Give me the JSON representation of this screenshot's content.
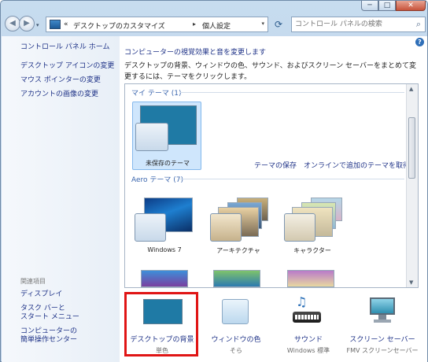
{
  "window": {
    "controls": {
      "minimize": "─",
      "maximize": "□",
      "close": "✕"
    }
  },
  "nav": {
    "back_icon": "back-arrow-icon",
    "forward_icon": "forward-arrow-icon",
    "breadcrumb": [
      "デスクトップのカスタマイズ",
      "個人設定"
    ],
    "breadcrumb_prefix": "«",
    "separator": "▸",
    "search_placeholder": "コントロール パネルの検索"
  },
  "sidebar": {
    "home": "コントロール パネル ホーム",
    "links": [
      "デスクトップ アイコンの変更",
      "マウス ポインターの変更",
      "アカウントの画像の変更"
    ],
    "see_also_heading": "関連項目",
    "see_also": [
      "ディスプレイ",
      "タスク バーと\nスタート メニュー",
      "コンピューターの\n簡単操作センター"
    ]
  },
  "main": {
    "title": "コンピューターの視覚効果と音を変更します",
    "description": "デスクトップの背景、ウィンドウの色、サウンド、およびスクリーン セーバーをまとめて変更するには、テーマをクリックします。",
    "my_themes_heading": "マイ テーマ (1)",
    "unsaved_theme": "未保存のテーマ",
    "save_theme_link": "テーマの保存",
    "online_link": "オンラインで追加のテーマを取得",
    "aero_heading": "Aero テーマ (7)",
    "aero_themes": [
      "Windows 7",
      "アーキテクチャ",
      "キャラクター"
    ]
  },
  "bottom": {
    "items": [
      {
        "label": "デスクトップの背景",
        "sub": "単色",
        "icon": "desktop-background-icon"
      },
      {
        "label": "ウィンドウの色",
        "sub": "そら",
        "icon": "window-color-icon"
      },
      {
        "label": "サウンド",
        "sub": "Windows 標準",
        "icon": "sound-notes-icon"
      },
      {
        "label": "スクリーン セーバー",
        "sub": "FMV スクリーンセーバー",
        "icon": "screensaver-monitor-icon"
      }
    ]
  },
  "colors": {
    "link": "#1e3287",
    "highlight_box": "#e01515",
    "desktop_solid": "#1f7aa5"
  }
}
